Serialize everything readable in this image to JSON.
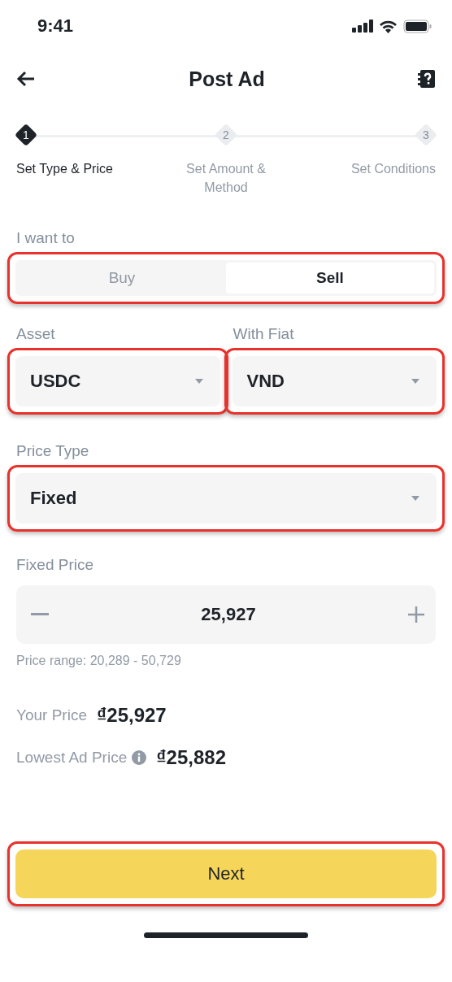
{
  "status_bar": {
    "time": "9:41"
  },
  "header": {
    "title": "Post Ad"
  },
  "steps": [
    {
      "number": "1",
      "label": "Set Type & Price",
      "selected": true
    },
    {
      "number": "2",
      "label": "Set Amount & Method",
      "selected": false
    },
    {
      "number": "3",
      "label": "Set Conditions",
      "selected": false
    }
  ],
  "trade_side": {
    "label": "I want to",
    "highlighted": true,
    "options": [
      {
        "label": "Buy",
        "selected": false
      },
      {
        "label": "Sell",
        "selected": true
      }
    ]
  },
  "asset": {
    "label": "Asset",
    "value": "USDC",
    "highlighted": true
  },
  "fiat": {
    "label": "With Fiat",
    "value": "VND",
    "highlighted": true
  },
  "price_type": {
    "label": "Price Type",
    "value": "Fixed",
    "highlighted": true
  },
  "fixed_price": {
    "label": "Fixed Price",
    "value": "25,927",
    "range": "Price range: 20,289 - 50,729"
  },
  "your_price": {
    "label": "Your Price",
    "value": "₫25,927"
  },
  "lowest_ad_price": {
    "label": "Lowest Ad Price",
    "value": "₫25,882"
  },
  "next_button": {
    "label": "Next",
    "highlighted": true
  }
}
